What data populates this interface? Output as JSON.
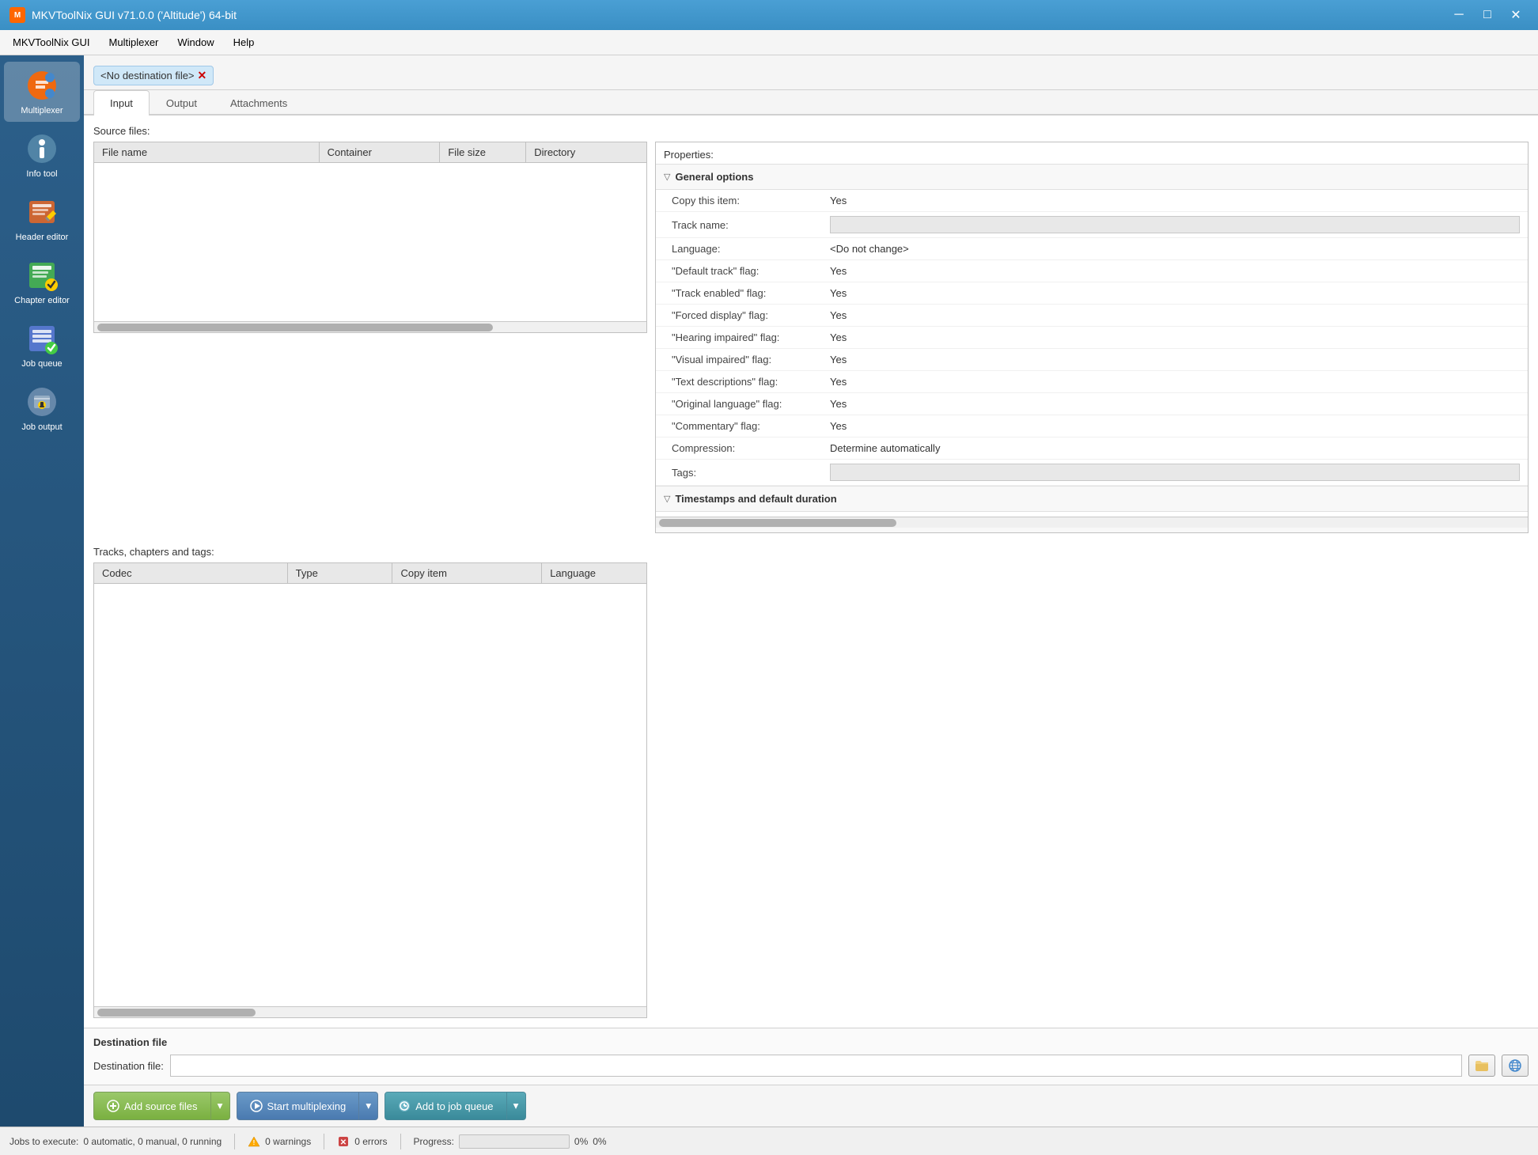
{
  "titlebar": {
    "title": "MKVToolNix GUI v71.0.0 ('Altitude') 64-bit",
    "icon": "M",
    "minimize": "─",
    "maximize": "□",
    "close": "✕"
  },
  "menubar": {
    "items": [
      "MKVToolNix GUI",
      "Multiplexer",
      "Window",
      "Help"
    ]
  },
  "sidebar": {
    "items": [
      {
        "id": "multiplexer",
        "label": "Multiplexer",
        "icon": "⚙"
      },
      {
        "id": "info-tool",
        "label": "Info tool",
        "icon": "🔍"
      },
      {
        "id": "header-editor",
        "label": "Header editor",
        "icon": "✏"
      },
      {
        "id": "chapter-editor",
        "label": "Chapter editor",
        "icon": "📋"
      },
      {
        "id": "job-queue",
        "label": "Job queue",
        "icon": "✅"
      },
      {
        "id": "job-output",
        "label": "Job output",
        "icon": "⚙"
      }
    ]
  },
  "destination_tag": "<No destination file>",
  "tabs": {
    "items": [
      "Input",
      "Output",
      "Attachments"
    ],
    "active": "Input"
  },
  "source_files": {
    "label": "Source files:",
    "columns": [
      "File name",
      "Container",
      "File size",
      "Directory"
    ],
    "rows": []
  },
  "tracks": {
    "label": "Tracks, chapters and tags:",
    "columns": [
      "Codec",
      "Type",
      "Copy item",
      "Language"
    ],
    "rows": []
  },
  "properties": {
    "label": "Properties:",
    "groups": [
      {
        "title": "General options",
        "expanded": true,
        "rows": [
          {
            "label": "Copy this item:",
            "value": "Yes",
            "type": "text"
          },
          {
            "label": "Track name:",
            "value": "",
            "type": "input"
          },
          {
            "label": "Language:",
            "value": "<Do not change>",
            "type": "text"
          },
          {
            "label": "\"Default track\" flag:",
            "value": "Yes",
            "type": "text"
          },
          {
            "label": "\"Track enabled\" flag:",
            "value": "Yes",
            "type": "text"
          },
          {
            "label": "\"Forced display\" flag:",
            "value": "Yes",
            "type": "text"
          },
          {
            "label": "\"Hearing impaired\" flag:",
            "value": "Yes",
            "type": "text"
          },
          {
            "label": "\"Visual impaired\" flag:",
            "value": "Yes",
            "type": "text"
          },
          {
            "label": "\"Text descriptions\" flag:",
            "value": "Yes",
            "type": "text"
          },
          {
            "label": "\"Original language\" flag:",
            "value": "Yes",
            "type": "text"
          },
          {
            "label": "\"Commentary\" flag:",
            "value": "Yes",
            "type": "text"
          },
          {
            "label": "Compression:",
            "value": "Determine automatically",
            "type": "text"
          },
          {
            "label": "Tags:",
            "value": "",
            "type": "input"
          }
        ]
      },
      {
        "title": "Timestamps and default duration",
        "expanded": false,
        "rows": []
      }
    ]
  },
  "destination_file": {
    "section_label": "Destination file",
    "row_label": "Destination file:",
    "value": "",
    "browse_btn": "📁",
    "clear_btn": "🌐"
  },
  "actions": {
    "add_source": "Add source files",
    "add_source_drop": "▾",
    "start_mux": "Start multiplexing",
    "start_mux_drop": "▾",
    "add_queue": "Add to job queue",
    "add_queue_drop": "▾"
  },
  "statusbar": {
    "jobs_label": "Jobs to execute:",
    "jobs_value": "0 automatic, 0 manual, 0 running",
    "warnings_label": "0 warnings",
    "errors_label": "0 errors",
    "progress_label": "Progress:",
    "progress_value": "0%",
    "right_value": "0%"
  }
}
